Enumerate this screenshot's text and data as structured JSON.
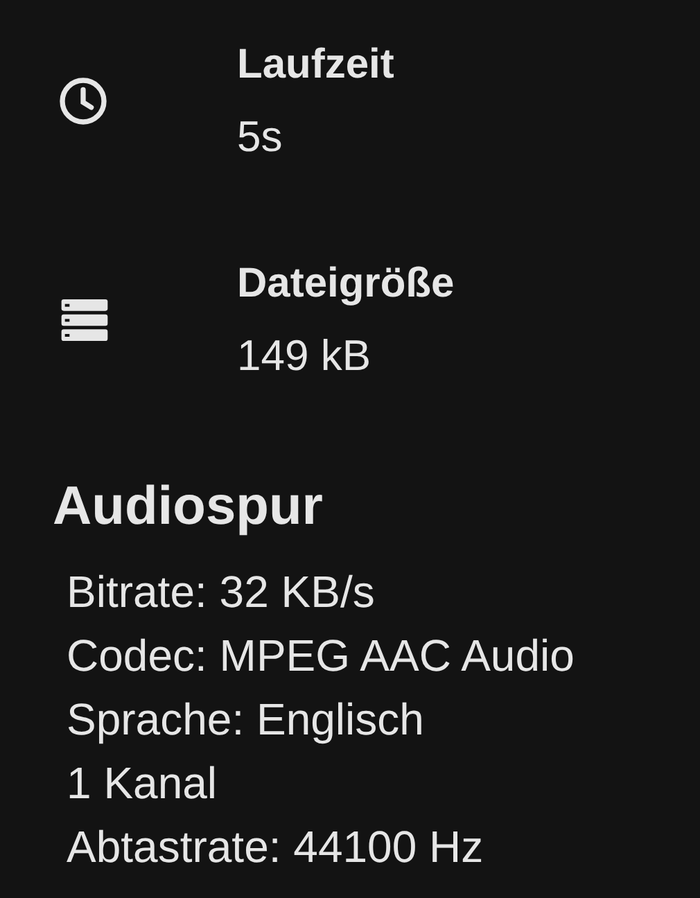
{
  "details": [
    {
      "kind": "clock",
      "label": "Laufzeit",
      "value": "5s"
    },
    {
      "kind": "storage",
      "label": "Dateigröße",
      "value": "149 kB"
    }
  ],
  "audio_track": {
    "title": "Audiospur",
    "lines": [
      "Bitrate: 32 KB/s",
      "Codec: MPEG AAC Audio",
      "Sprache: Englisch",
      "1 Kanal",
      "Abtastrate: 44100 Hz"
    ]
  }
}
